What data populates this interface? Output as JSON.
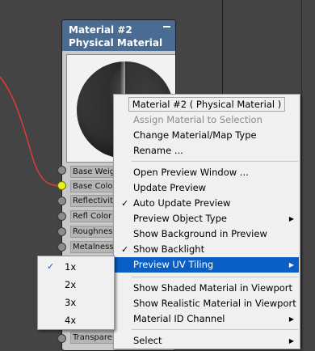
{
  "node": {
    "title_line1": "Material #2",
    "title_line2": "Physical Material",
    "slots": [
      "Base Weight",
      "Base Color",
      "Reflectivity",
      "Refl Color Map",
      "Roughness",
      "Metalness Map",
      "Transparency"
    ],
    "active_slot": "Base Color"
  },
  "context_menu": {
    "title": "Material #2  ( Physical Material )",
    "items": [
      {
        "label": "Assign Material to Selection",
        "disabled": true
      },
      {
        "label": "Change Material/Map Type"
      },
      {
        "label": "Rename ..."
      },
      {
        "label": "Open Preview Window ..."
      },
      {
        "label": "Update Preview"
      },
      {
        "label": "Auto Update Preview",
        "checked": true
      },
      {
        "label": "Preview Object Type",
        "submenu": true
      },
      {
        "label": "Show Background in Preview"
      },
      {
        "label": "Show Backlight",
        "checked": true
      },
      {
        "label": "Preview UV Tiling",
        "submenu": true,
        "highlighted": true
      },
      {
        "label": "Show Shaded Material in Viewport"
      },
      {
        "label": "Show Realistic Material in Viewport"
      },
      {
        "label": "Material ID Channel",
        "submenu": true
      },
      {
        "label": "Select",
        "submenu": true
      }
    ]
  },
  "uv_tiling_submenu": {
    "items": [
      "1x",
      "2x",
      "3x",
      "4x"
    ],
    "selected": "1x"
  },
  "colors": {
    "canvas_bg": "#444444",
    "node_header": "#4a6c93",
    "highlight": "#0a5fc4",
    "wire": "#e03a3a",
    "active_socket": "#e6f21a"
  },
  "icons": {
    "checkmark": "checkmark-icon",
    "submenu": "submenu-arrow-icon",
    "collapse": "collapse-icon"
  }
}
